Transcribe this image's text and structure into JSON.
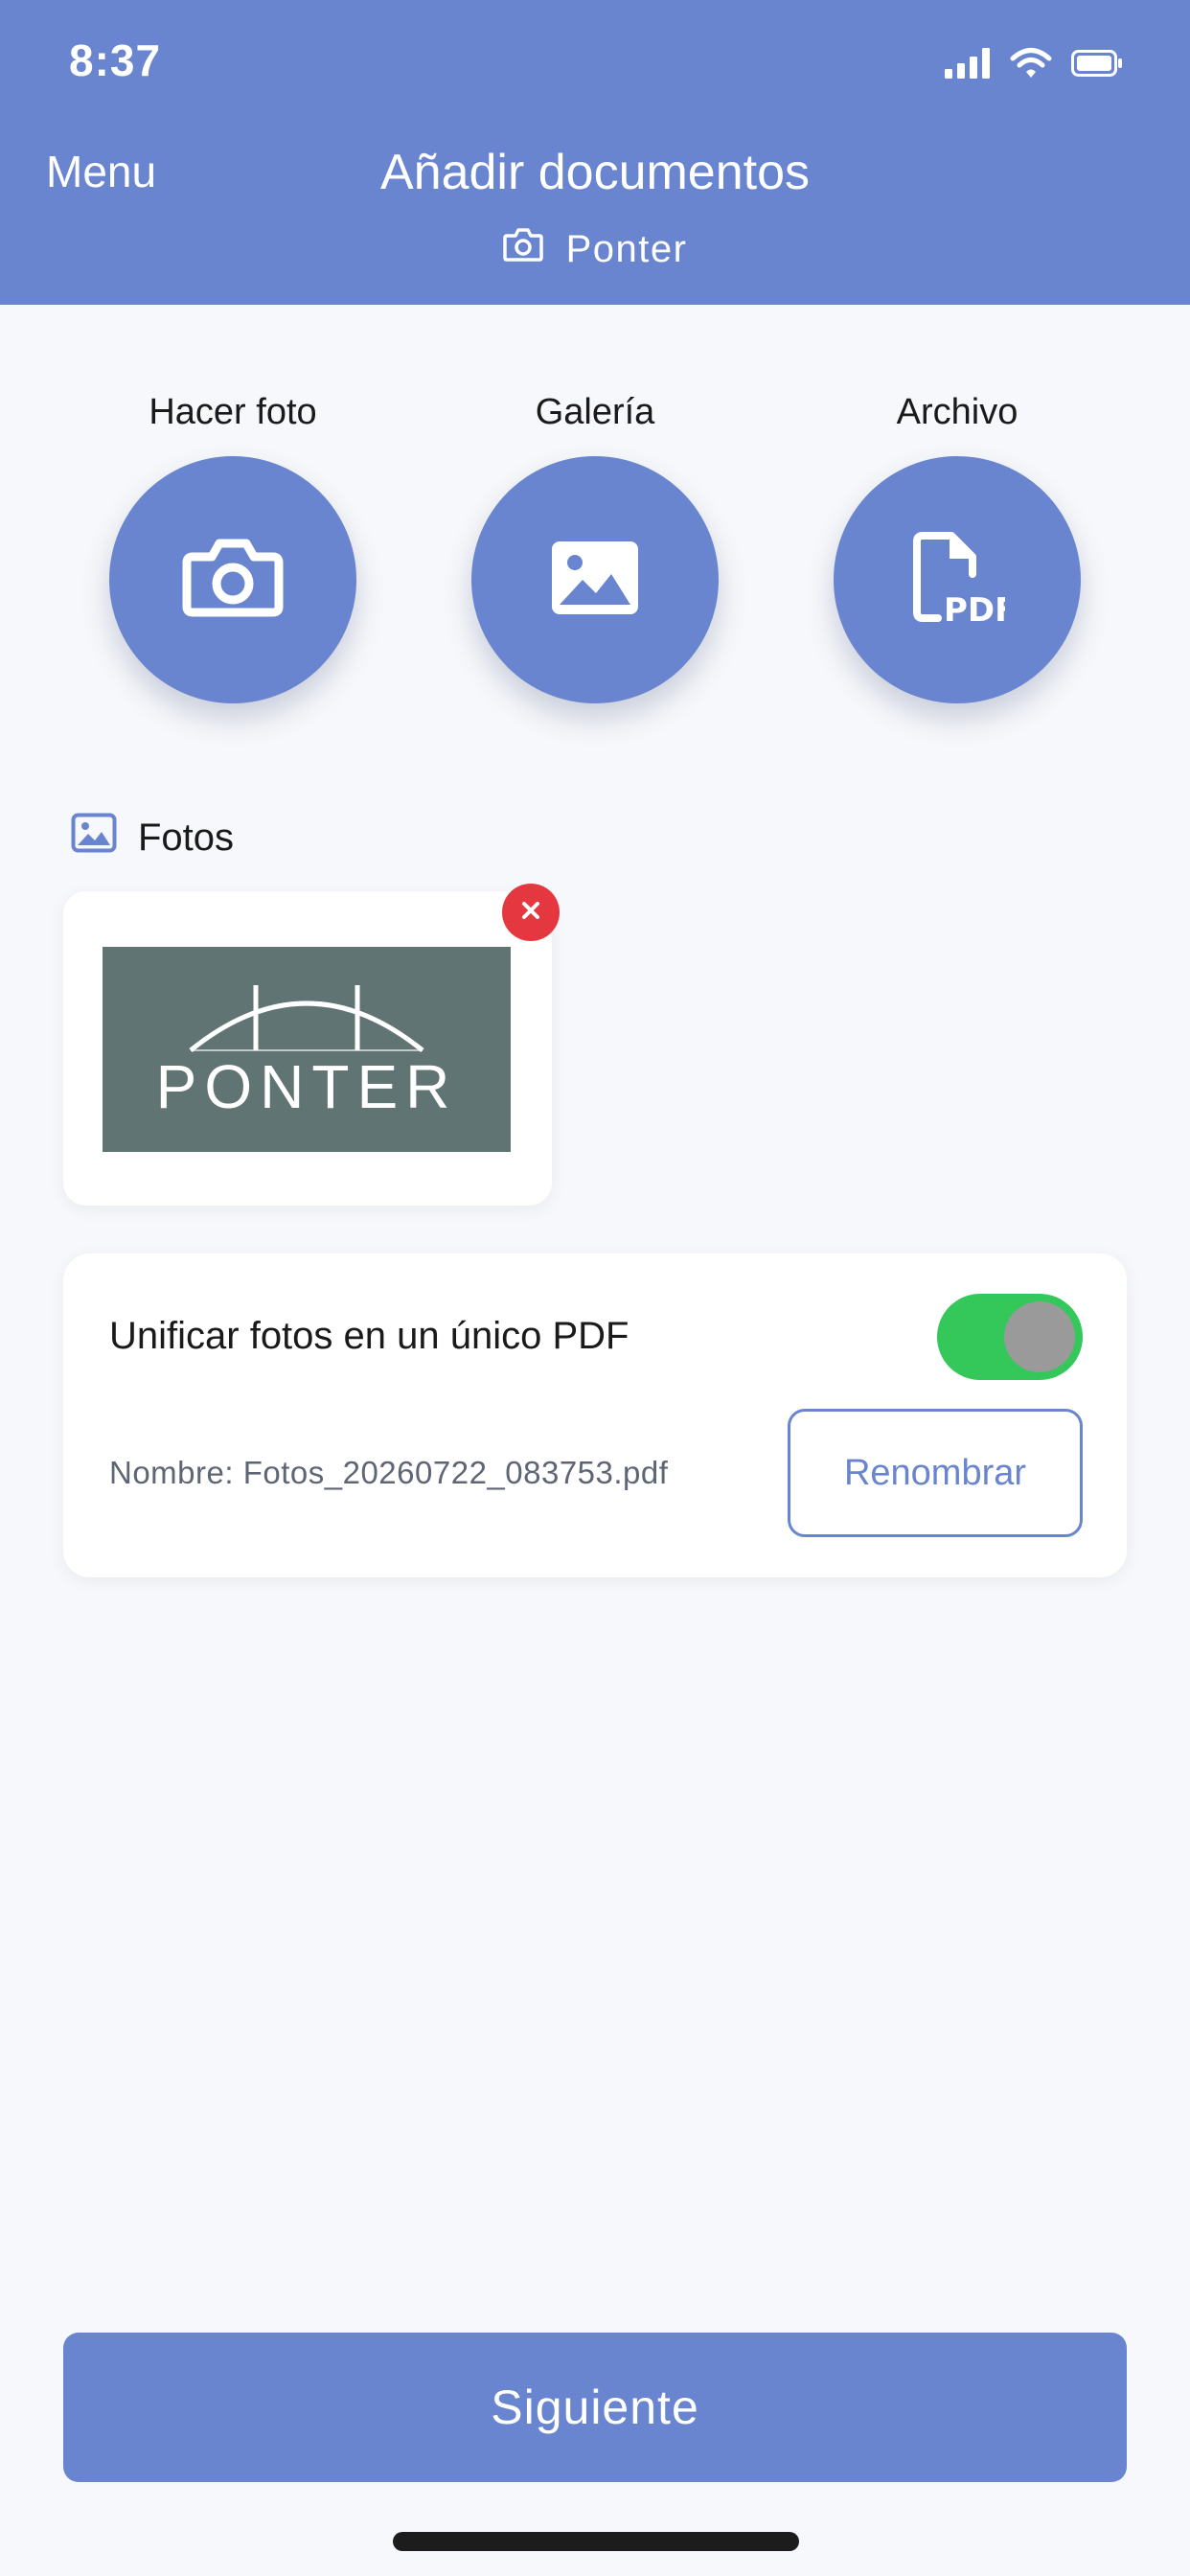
{
  "status_bar": {
    "time": "8:37",
    "icons": [
      "signal-icon",
      "wifi-icon",
      "battery-icon"
    ]
  },
  "nav": {
    "menu_label": "Menu",
    "title": "Añadir documentos",
    "subtitle": "Ponter",
    "subtitle_icon": "camera-icon"
  },
  "actions": [
    {
      "label": "Hacer foto",
      "icon": "camera-icon"
    },
    {
      "label": "Galería",
      "icon": "image-icon"
    },
    {
      "label": "Archivo",
      "icon": "pdf-file-icon"
    }
  ],
  "photos_section": {
    "title": "Fotos",
    "icon": "image-icon",
    "items": [
      {
        "thumbnail_text": "PONTER"
      }
    ]
  },
  "unify": {
    "label": "Unificar fotos en un único PDF",
    "enabled": true,
    "file_name": "Nombre: Fotos_20260722_083753.pdf",
    "rename_label": "Renombrar"
  },
  "footer": {
    "next_label": "Siguiente"
  },
  "colors": {
    "primary": "#6a85cf",
    "toggle_on": "#34c759",
    "remove": "#e5373f",
    "background": "#f7f8fb",
    "thumbnail_bg": "#5f7473"
  }
}
